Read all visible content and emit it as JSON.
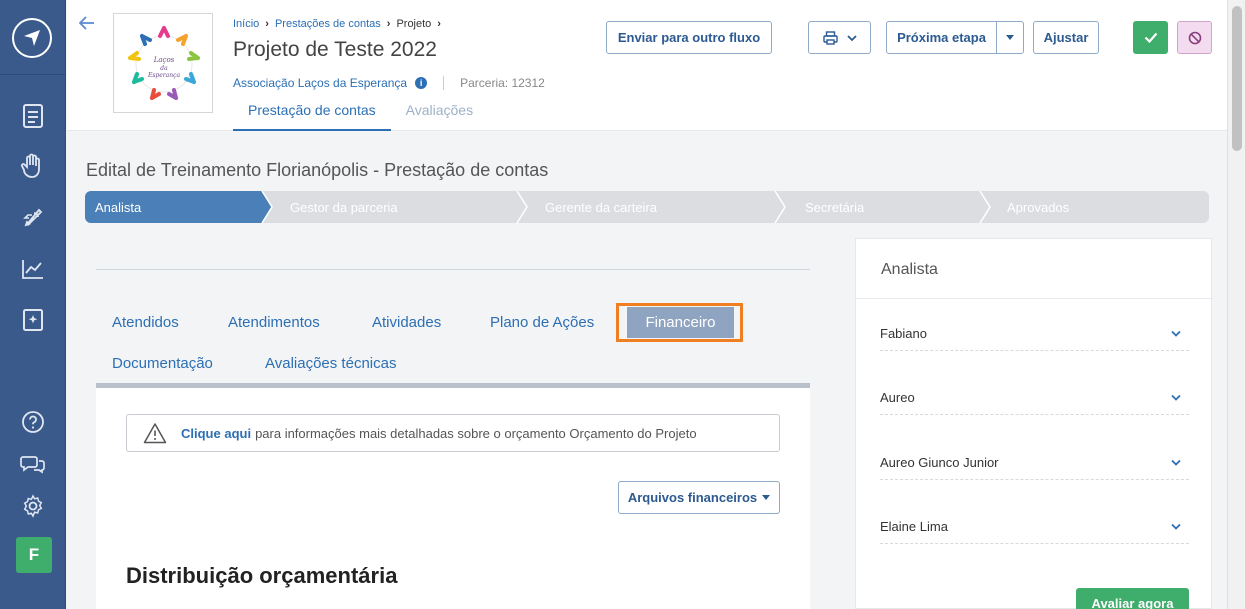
{
  "breadcrumb": {
    "home": "Início",
    "prestacoes": "Prestações de contas",
    "projeto": "Projeto"
  },
  "project": {
    "title": "Projeto de Teste 2022",
    "organization": "Associação Laços da Esperança",
    "parceria": "Parceria: 12312",
    "logo_text": "Laços da Esperança"
  },
  "header_tabs": {
    "prestacao": "Prestação de contas",
    "avaliacoes": "Avaliações"
  },
  "buttons": {
    "enviar": "Enviar para outro fluxo",
    "proxima": "Próxima etapa",
    "ajustar": "Ajustar",
    "print_icon": "printer-icon"
  },
  "edital_title": "Edital de Treinamento Florianópolis - Prestação de contas",
  "steps": [
    "Analista",
    "Gestor da parceria",
    "Gerente da carteira",
    "Secretária",
    "Aprovados"
  ],
  "content_tabs": {
    "atendidos": "Atendidos",
    "atendimentos": "Atendimentos",
    "atividades": "Atividades",
    "plano": "Plano de Ações",
    "financeiro": "Financeiro",
    "documentacao": "Documentação",
    "avaliacoes_tecnicas": "Avaliações técnicas"
  },
  "alert": {
    "link": "Clique aqui",
    "text": "para informações mais detalhadas sobre o orçamento Orçamento do Projeto"
  },
  "arquivos_btn": "Arquivos financeiros",
  "section_title": "Distribuição orçamentária",
  "right_panel": {
    "title": "Analista",
    "people": [
      "Fabiano",
      "Aureo",
      "Aureo Giunco Junior",
      "Elaine Lima"
    ],
    "avaliar": "Avaliar agora"
  },
  "user_initial": "F",
  "colors": {
    "sidebar": "#3b5a8c",
    "accent": "#2c6fb4",
    "green": "#3fae6d",
    "highlight": "#f07f24"
  }
}
